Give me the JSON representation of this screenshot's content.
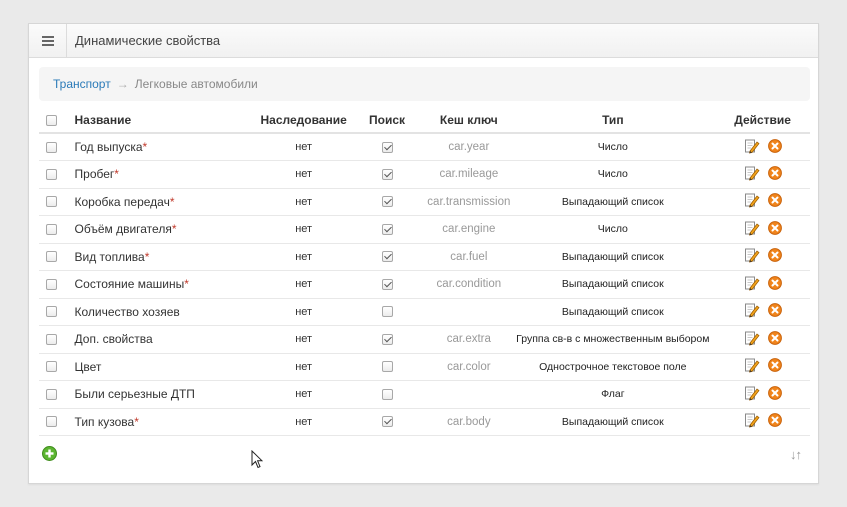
{
  "header": {
    "title": "Динамические свойства",
    "menu_icon": "hamburger-icon"
  },
  "breadcrumb": {
    "parent": "Транспорт",
    "separator": "→",
    "current": "Легковые автомобили"
  },
  "table": {
    "columns": {
      "name": "Название",
      "inheritance": "Наследование",
      "search": "Поиск",
      "cache_key": "Кеш ключ",
      "type": "Тип",
      "action": "Действие"
    },
    "required_mark": "*",
    "rows": [
      {
        "name": "Год выпуска",
        "required": true,
        "inheritance": "нет",
        "search": true,
        "cache_key": "car.year",
        "type": "Число"
      },
      {
        "name": "Пробег",
        "required": true,
        "inheritance": "нет",
        "search": true,
        "cache_key": "car.mileage",
        "type": "Число"
      },
      {
        "name": "Коробка передач",
        "required": true,
        "inheritance": "нет",
        "search": true,
        "cache_key": "car.transmission",
        "type": "Выпадающий список"
      },
      {
        "name": "Объём двигателя",
        "required": true,
        "inheritance": "нет",
        "search": true,
        "cache_key": "car.engine",
        "type": "Число"
      },
      {
        "name": "Вид топлива",
        "required": true,
        "inheritance": "нет",
        "search": true,
        "cache_key": "car.fuel",
        "type": "Выпадающий список"
      },
      {
        "name": "Состояние машины",
        "required": true,
        "inheritance": "нет",
        "search": true,
        "cache_key": "car.condition",
        "type": "Выпадающий список"
      },
      {
        "name": "Количество хозяев",
        "required": false,
        "inheritance": "нет",
        "search": false,
        "cache_key": "",
        "type": "Выпадающий список"
      },
      {
        "name": "Доп. свойства",
        "required": false,
        "inheritance": "нет",
        "search": true,
        "cache_key": "car.extra",
        "type": "Группа св-в с множественным выбором"
      },
      {
        "name": "Цвет",
        "required": false,
        "inheritance": "нет",
        "search": false,
        "cache_key": "car.color",
        "type": "Однострочное текстовое поле"
      },
      {
        "name": "Были серьезные ДТП",
        "required": false,
        "inheritance": "нет",
        "search": false,
        "cache_key": "",
        "type": "Флаг"
      },
      {
        "name": "Тип кузова",
        "required": true,
        "inheritance": "нет",
        "search": true,
        "cache_key": "car.body",
        "type": "Выпадающий список"
      }
    ]
  },
  "footer": {
    "add_icon": "add-icon",
    "sort_glyph": "↓↑"
  },
  "colors": {
    "link": "#2a7ab8",
    "required": "#c0392b",
    "add_green": "#5cb531",
    "delete_orange": "#f0841b"
  }
}
